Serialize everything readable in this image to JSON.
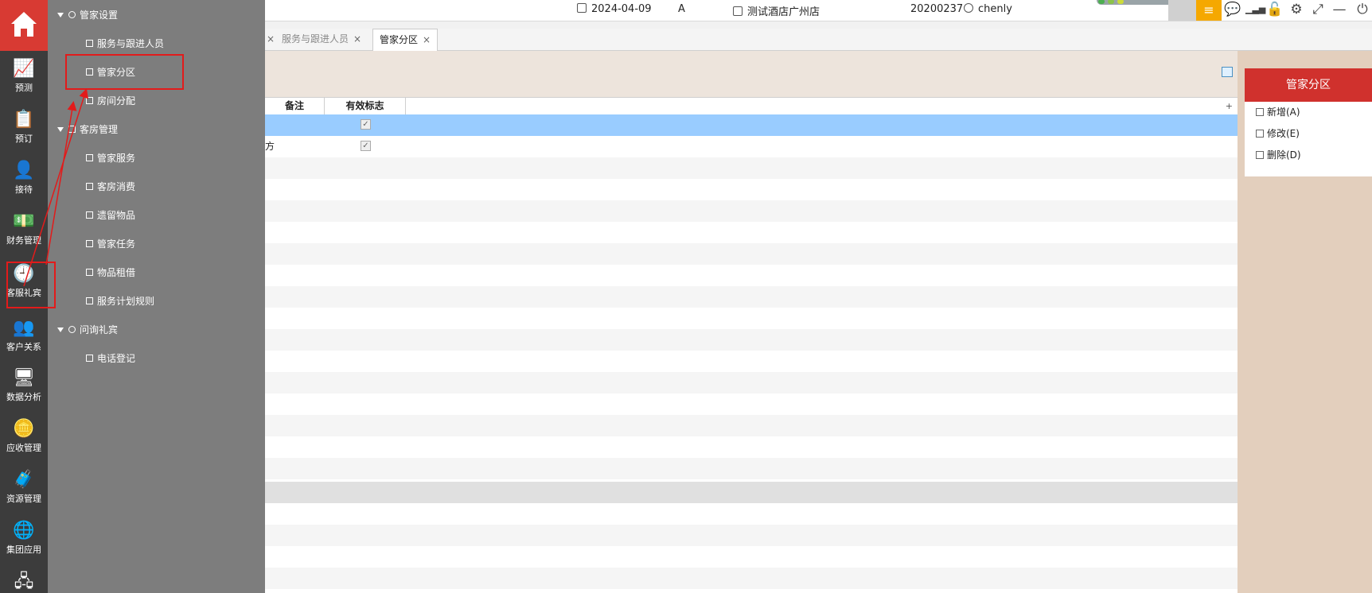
{
  "topbar": {
    "date": "2024-04-09",
    "shift": "A",
    "hotel": "测试酒店广州店",
    "user_code": "20200237",
    "username": "chenly"
  },
  "tabs": [
    {
      "label": "服务与跟进人员",
      "active": false
    },
    {
      "label": "管家分区",
      "active": true
    }
  ],
  "grid": {
    "columns": [
      "备注",
      "有效标志"
    ],
    "rows": [
      {
        "note": "",
        "valid": true,
        "selected": true
      },
      {
        "note": "方",
        "valid": true,
        "selected": false
      }
    ]
  },
  "right_panel": {
    "title": "管家分区",
    "actions": [
      {
        "label": "新增(A)",
        "icon": "plus-icon"
      },
      {
        "label": "修改(E)",
        "icon": "edit-icon"
      },
      {
        "label": "删除(D)",
        "icon": "trash-icon"
      }
    ]
  },
  "leftnav": {
    "items": [
      {
        "label": "预测",
        "icon": "chart-icon"
      },
      {
        "label": "预订",
        "icon": "clipboard-icon"
      },
      {
        "label": "接待",
        "icon": "person-icon"
      },
      {
        "label": "财务管理",
        "icon": "money-icon"
      },
      {
        "label": "客服礼宾",
        "icon": "clock-icon"
      },
      {
        "label": "客户关系",
        "icon": "users-icon"
      },
      {
        "label": "数据分析",
        "icon": "monitor-chart-icon"
      },
      {
        "label": "应收管理",
        "icon": "coins-icon"
      },
      {
        "label": "资源管理",
        "icon": "porter-icon"
      },
      {
        "label": "集团应用",
        "icon": "globe-icon"
      }
    ]
  },
  "submenu": {
    "groups": [
      {
        "label": "管家设置",
        "items": [
          "服务与跟进人员",
          "管家分区",
          "房间分配"
        ]
      },
      {
        "label": "客房管理",
        "items": [
          "管家服务",
          "客房消费",
          "遗留物品",
          "管家任务",
          "物品租借",
          "服务计划规则"
        ]
      },
      {
        "label": "问询礼宾",
        "items": [
          "电话登记"
        ]
      }
    ]
  },
  "colors": {
    "brand_red": "#d83a33",
    "panel_title_red": "#d0312d",
    "selected_row": "#99ccff",
    "annotation_red": "#e21b1b"
  }
}
